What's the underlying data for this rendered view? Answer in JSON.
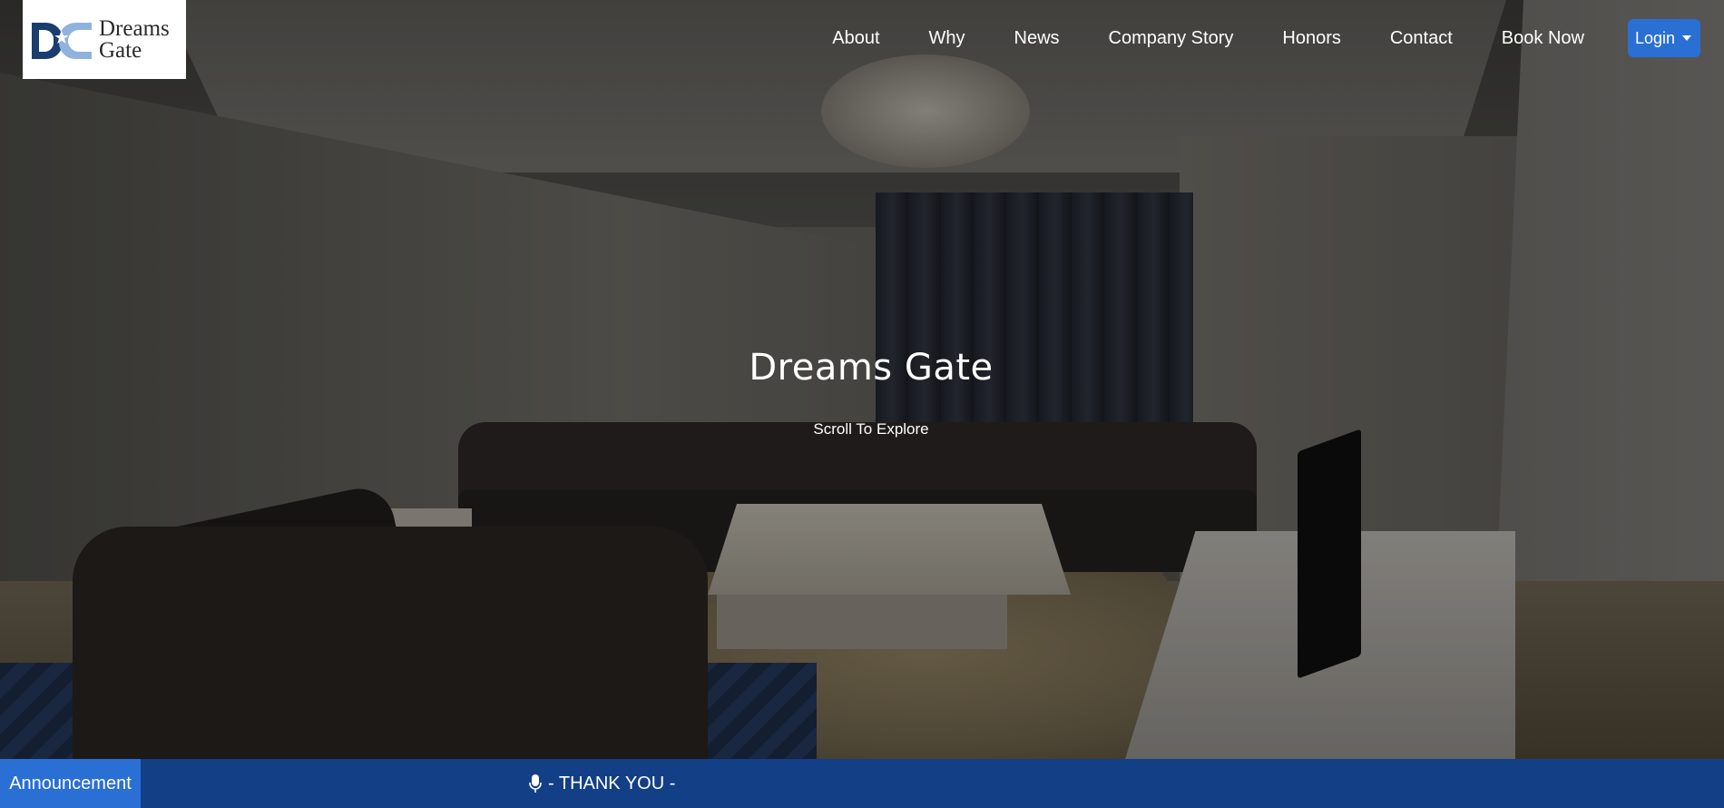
{
  "header": {
    "logo_line1": "Dreams",
    "logo_line2": "Gate"
  },
  "nav": {
    "items": [
      {
        "label": "About"
      },
      {
        "label": "Why"
      },
      {
        "label": "News"
      },
      {
        "label": "Company Story"
      },
      {
        "label": "Honors"
      },
      {
        "label": "Contact"
      },
      {
        "label": "Book Now"
      }
    ],
    "login_label": "Login"
  },
  "hero": {
    "title": "Dreams Gate",
    "subtitle": "Scroll To Explore"
  },
  "announcement": {
    "label": "Announcement",
    "message": "- THANK YOU -",
    "icon": "microphone-icon"
  },
  "colors": {
    "accent": "#2a6fd4",
    "announcement_bar": "#133f87"
  }
}
